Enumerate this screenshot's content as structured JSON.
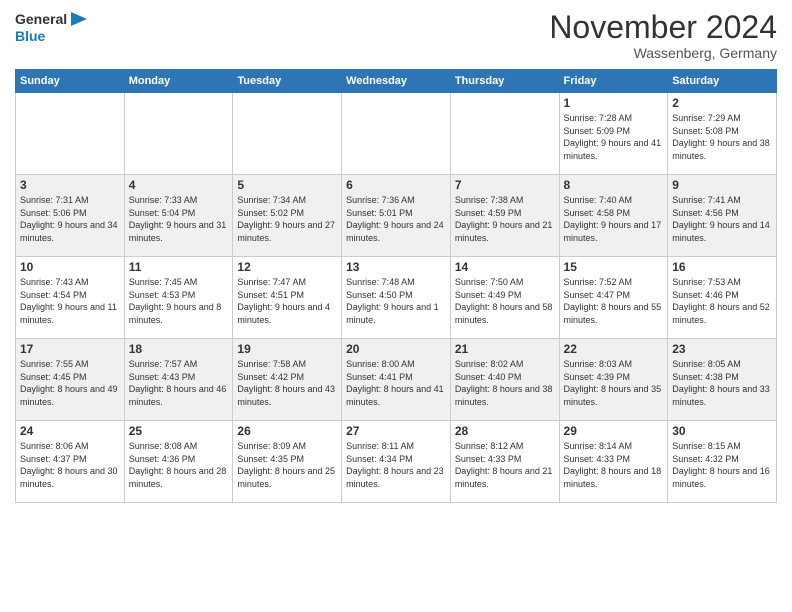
{
  "header": {
    "logo_general": "General",
    "logo_blue": "Blue",
    "month_title": "November 2024",
    "location": "Wassenberg, Germany"
  },
  "weekdays": [
    "Sunday",
    "Monday",
    "Tuesday",
    "Wednesday",
    "Thursday",
    "Friday",
    "Saturday"
  ],
  "weeks": [
    [
      {
        "day": "",
        "info": ""
      },
      {
        "day": "",
        "info": ""
      },
      {
        "day": "",
        "info": ""
      },
      {
        "day": "",
        "info": ""
      },
      {
        "day": "",
        "info": ""
      },
      {
        "day": "1",
        "info": "Sunrise: 7:28 AM\nSunset: 5:09 PM\nDaylight: 9 hours and 41 minutes."
      },
      {
        "day": "2",
        "info": "Sunrise: 7:29 AM\nSunset: 5:08 PM\nDaylight: 9 hours and 38 minutes."
      }
    ],
    [
      {
        "day": "3",
        "info": "Sunrise: 7:31 AM\nSunset: 5:06 PM\nDaylight: 9 hours and 34 minutes."
      },
      {
        "day": "4",
        "info": "Sunrise: 7:33 AM\nSunset: 5:04 PM\nDaylight: 9 hours and 31 minutes."
      },
      {
        "day": "5",
        "info": "Sunrise: 7:34 AM\nSunset: 5:02 PM\nDaylight: 9 hours and 27 minutes."
      },
      {
        "day": "6",
        "info": "Sunrise: 7:36 AM\nSunset: 5:01 PM\nDaylight: 9 hours and 24 minutes."
      },
      {
        "day": "7",
        "info": "Sunrise: 7:38 AM\nSunset: 4:59 PM\nDaylight: 9 hours and 21 minutes."
      },
      {
        "day": "8",
        "info": "Sunrise: 7:40 AM\nSunset: 4:58 PM\nDaylight: 9 hours and 17 minutes."
      },
      {
        "day": "9",
        "info": "Sunrise: 7:41 AM\nSunset: 4:56 PM\nDaylight: 9 hours and 14 minutes."
      }
    ],
    [
      {
        "day": "10",
        "info": "Sunrise: 7:43 AM\nSunset: 4:54 PM\nDaylight: 9 hours and 11 minutes."
      },
      {
        "day": "11",
        "info": "Sunrise: 7:45 AM\nSunset: 4:53 PM\nDaylight: 9 hours and 8 minutes."
      },
      {
        "day": "12",
        "info": "Sunrise: 7:47 AM\nSunset: 4:51 PM\nDaylight: 9 hours and 4 minutes."
      },
      {
        "day": "13",
        "info": "Sunrise: 7:48 AM\nSunset: 4:50 PM\nDaylight: 9 hours and 1 minute."
      },
      {
        "day": "14",
        "info": "Sunrise: 7:50 AM\nSunset: 4:49 PM\nDaylight: 8 hours and 58 minutes."
      },
      {
        "day": "15",
        "info": "Sunrise: 7:52 AM\nSunset: 4:47 PM\nDaylight: 8 hours and 55 minutes."
      },
      {
        "day": "16",
        "info": "Sunrise: 7:53 AM\nSunset: 4:46 PM\nDaylight: 8 hours and 52 minutes."
      }
    ],
    [
      {
        "day": "17",
        "info": "Sunrise: 7:55 AM\nSunset: 4:45 PM\nDaylight: 8 hours and 49 minutes."
      },
      {
        "day": "18",
        "info": "Sunrise: 7:57 AM\nSunset: 4:43 PM\nDaylight: 8 hours and 46 minutes."
      },
      {
        "day": "19",
        "info": "Sunrise: 7:58 AM\nSunset: 4:42 PM\nDaylight: 8 hours and 43 minutes."
      },
      {
        "day": "20",
        "info": "Sunrise: 8:00 AM\nSunset: 4:41 PM\nDaylight: 8 hours and 41 minutes."
      },
      {
        "day": "21",
        "info": "Sunrise: 8:02 AM\nSunset: 4:40 PM\nDaylight: 8 hours and 38 minutes."
      },
      {
        "day": "22",
        "info": "Sunrise: 8:03 AM\nSunset: 4:39 PM\nDaylight: 8 hours and 35 minutes."
      },
      {
        "day": "23",
        "info": "Sunrise: 8:05 AM\nSunset: 4:38 PM\nDaylight: 8 hours and 33 minutes."
      }
    ],
    [
      {
        "day": "24",
        "info": "Sunrise: 8:06 AM\nSunset: 4:37 PM\nDaylight: 8 hours and 30 minutes."
      },
      {
        "day": "25",
        "info": "Sunrise: 8:08 AM\nSunset: 4:36 PM\nDaylight: 8 hours and 28 minutes."
      },
      {
        "day": "26",
        "info": "Sunrise: 8:09 AM\nSunset: 4:35 PM\nDaylight: 8 hours and 25 minutes."
      },
      {
        "day": "27",
        "info": "Sunrise: 8:11 AM\nSunset: 4:34 PM\nDaylight: 8 hours and 23 minutes."
      },
      {
        "day": "28",
        "info": "Sunrise: 8:12 AM\nSunset: 4:33 PM\nDaylight: 8 hours and 21 minutes."
      },
      {
        "day": "29",
        "info": "Sunrise: 8:14 AM\nSunset: 4:33 PM\nDaylight: 8 hours and 18 minutes."
      },
      {
        "day": "30",
        "info": "Sunrise: 8:15 AM\nSunset: 4:32 PM\nDaylight: 8 hours and 16 minutes."
      }
    ]
  ]
}
